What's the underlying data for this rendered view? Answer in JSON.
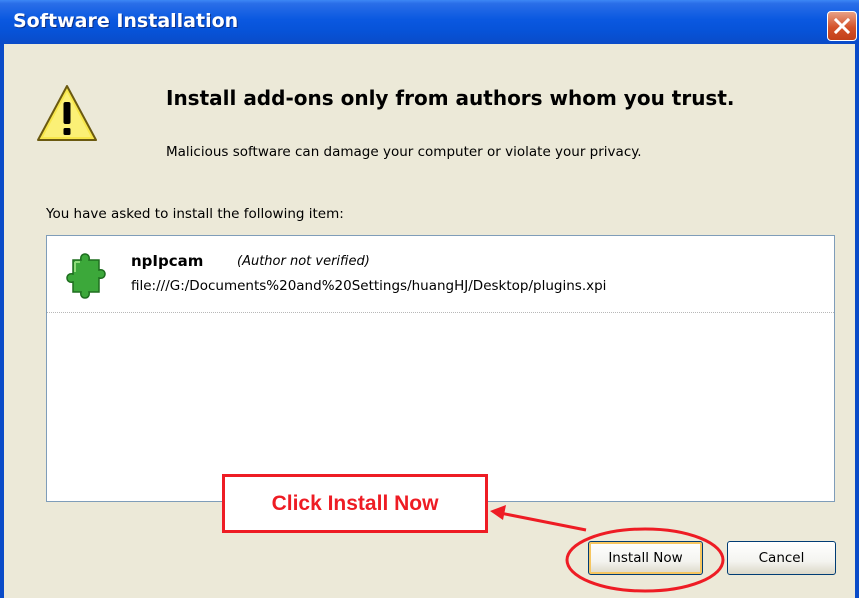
{
  "window": {
    "title": "Software Installation",
    "close_icon": "close-icon"
  },
  "dialog": {
    "warning_icon": "warning-icon",
    "headline": "Install add-ons only from authors whom you trust.",
    "subline": "Malicious software can damage your computer or violate your privacy.",
    "list_label": "You have asked to install the following item:",
    "items": [
      {
        "icon": "puzzle-icon",
        "name": "npIpcam",
        "note": "(Author not verified)",
        "url": "file:///G:/Documents%20and%20Settings/huangHJ/Desktop/plugins.xpi"
      }
    ]
  },
  "buttons": {
    "install": "Install Now",
    "cancel": "Cancel"
  },
  "annotation": {
    "callout_text": "Click Install Now",
    "color": "#ee1c24"
  },
  "colors": {
    "titlebar": "#0a58e0",
    "dialog_bg": "#ece9d8",
    "close_button": "#d4522a"
  }
}
